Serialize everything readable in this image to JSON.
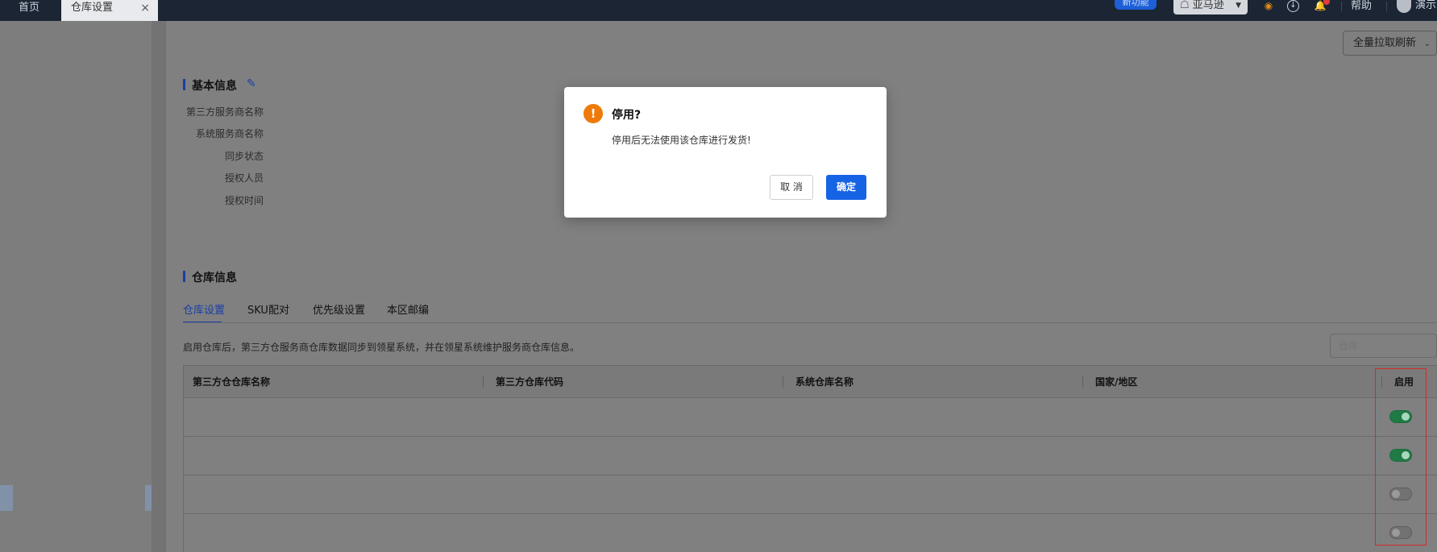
{
  "topbar": {
    "tabs": [
      {
        "label": "首页"
      },
      {
        "label": "仓库设置",
        "close": "×"
      }
    ],
    "new_feature_badge": "新功能",
    "platform_select": "亚马逊",
    "help": "帮助",
    "user_name": "演示"
  },
  "toolbar": {
    "refresh_label": "全量拉取刷新"
  },
  "basic_info": {
    "title": "基本信息",
    "labels": [
      "第三方服务商名称",
      "系统服务商名称",
      "同步状态",
      "授权人员",
      "授权时间"
    ]
  },
  "warehouse_info": {
    "title": "仓库信息",
    "tabs": [
      "仓库设置",
      "SKU配对",
      "优先级设置",
      "本区邮编"
    ],
    "active_tab": 0,
    "description": "启用仓库后，第三方仓服务商仓库数据同步到领星系统，并在领星系统维护服务商仓库信息。",
    "search_placeholder": "仓库",
    "table": {
      "columns": [
        "第三方仓仓库名称",
        "第三方仓库代码",
        "系统仓库名称",
        "国家/地区",
        "启用"
      ],
      "rows": [
        {
          "enabled": true
        },
        {
          "enabled": true
        },
        {
          "enabled": false
        },
        {
          "enabled": false
        }
      ]
    }
  },
  "modal": {
    "title": "停用?",
    "message": "停用后无法使用该仓库进行发货!",
    "cancel_label": "取 消",
    "confirm_label": "确定"
  },
  "colors": {
    "accent": "#1763e6",
    "warning": "#ee7a0a",
    "toggle_on": "#1f7a45",
    "highlight": "#d42b2b",
    "topbar": "#1b2533"
  }
}
